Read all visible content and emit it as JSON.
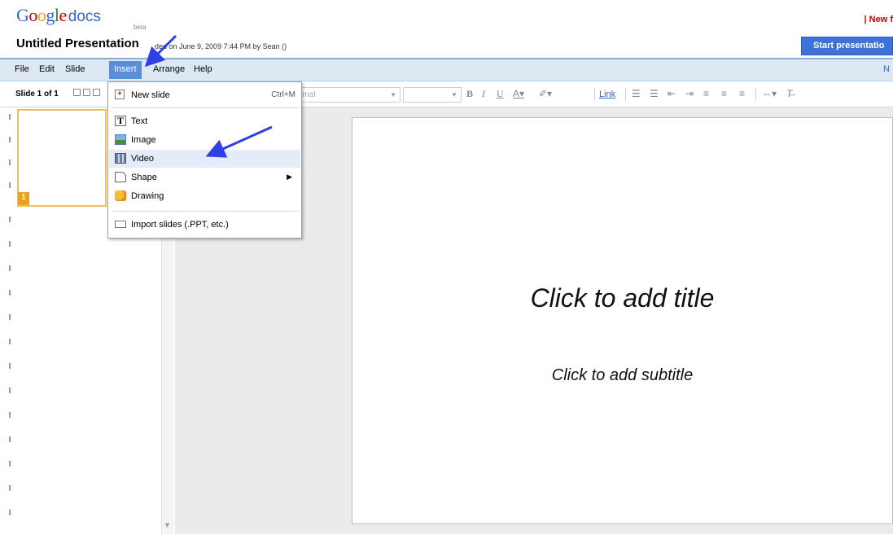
{
  "app": {
    "logo_google": "Google",
    "logo_docs": "docs",
    "logo_beta": "beta",
    "top_right_link": "| New f"
  },
  "document": {
    "title": "Untitled Presentation",
    "saved_info": "ded on June 9, 2009 7:44 PM by Sean ()"
  },
  "start_button": "Start presentatio",
  "menubar": {
    "items": [
      "File",
      "Edit",
      "Slide",
      "Insert",
      "Arrange",
      "Help"
    ],
    "right_label": "N"
  },
  "toolbar": {
    "slide_count": "Slide 1 of 1",
    "font_placeholder": "rmal",
    "link_label": "Link"
  },
  "insert_menu": {
    "items": [
      {
        "label": "New slide",
        "shortcut": "Ctrl+M",
        "icon": "new-slide-icon"
      },
      {
        "label": "Text",
        "icon": "text-icon"
      },
      {
        "label": "Image",
        "icon": "image-icon"
      },
      {
        "label": "Video",
        "icon": "video-icon",
        "highlighted": true
      },
      {
        "label": "Shape",
        "icon": "shape-icon",
        "submenu": true
      },
      {
        "label": "Drawing",
        "icon": "drawing-icon"
      },
      {
        "label": "Import slides (.PPT, etc.)",
        "icon": "import-icon"
      }
    ]
  },
  "thumbnail": {
    "number": "1"
  },
  "slide": {
    "title_placeholder": "Click to add title",
    "subtitle_placeholder": "Click to add subtitle"
  },
  "colors": {
    "menubar_bg": "#dde8f5",
    "active_menu": "#5b8ed6",
    "start_button": "#3d73d8",
    "annotation_arrow": "#2f3fe6",
    "thumb_border": "#f0c060"
  }
}
